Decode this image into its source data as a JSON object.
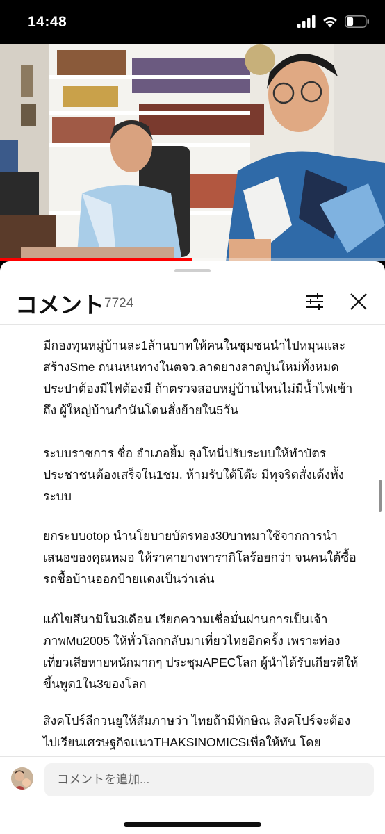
{
  "status": {
    "time": "14:48",
    "battery_level": 0.35
  },
  "video": {
    "progress": 0.5
  },
  "comments_panel": {
    "title": "コメント",
    "count": "7724",
    "filter_icon": "sliders-icon",
    "close_icon": "close-icon",
    "paragraphs": [
      "มีกองทุนหมู่บ้านละ1ล้านบาทให้คนในชุมชนนำไปหมุนและสร้างSme  ถนนหนทางในตจว.ลาดยางลาดปูนใหม่ทั้งหมด ประปาต้องมีไฟต้องมี  ถ้าตรวจสอบหมู่บ้านไหนไม่มีน้ำไฟเข้าถึง ผู้ใหญ่บ้านกำนันโดนสั่งย้ายใน5วัน",
      "ระบบราชการ ชื่อ อำเภอยิ้ม ลุงโทนี่ปรับระบบให้ทำบัตรประชาชนต้องเสร็จใน1ชม. ห้ามรับใต้โต๊ะ มีทุจริตสั่งเด้งทั้งระบบ",
      "ยกระบบotop นำนโยบายบัตรทอง30บาทมาใช้จากการนำเสนอของคุณหมอ ให้ราคายางพารากิโลร้อยกว่า จนคนใต้ซื้อรถซื้อบ้านออกป้ายแดงเป็นว่าเล่น",
      "แก้ไขสึนามิใน3เดือน เรียกความเชื่อมั่นผ่านการเป็นเจ้าภาพMu2005 ให้ทั่วโลกกลับมาเที่ยวไทยอีกครั้ง เพราะท่องเที่ยวเสียหายหนักมากๆ ประชุมAPECโลก ผู้นำได้รับเกียรติให้ขึ้นพูด1ใน3ของโลก",
      "สิงคโปร์ลีกวนยูให้สัมภาษว่า ไทยถ้ามีทักษิณ สิงคโปร์จะต้องไปเรียนเศรษฐกิจแนวTHAKSINOMICSเพื่อให้ทัน โดย"
    ],
    "add_comment_placeholder": "コメントを追加..."
  }
}
